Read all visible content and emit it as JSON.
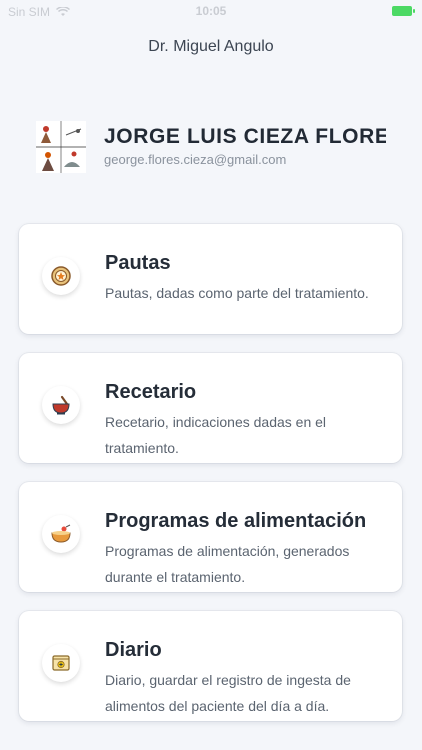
{
  "status_bar": {
    "carrier": "Sin SIM",
    "time": "10:05"
  },
  "header": {
    "doctor_name": "Dr. Miguel Angulo"
  },
  "profile": {
    "name": "JORGE LUIS CIEZA FLORES",
    "email": "george.flores.cieza@gmail.com"
  },
  "cards": [
    {
      "title": "Pautas",
      "description": "Pautas, dadas como parte del tratamiento.",
      "icon": "star-seal-icon"
    },
    {
      "title": "Recetario",
      "description": "Recetario, indicaciones dadas en el tratamiento.",
      "icon": "mortar-pestle-icon"
    },
    {
      "title": "Programas de alimentación",
      "description": "Programas de alimentación, generados durante el tratamiento.",
      "icon": "food-bowl-icon"
    },
    {
      "title": "Diario",
      "description": "Diario, guardar el registro de ingesta de alimentos del paciente del día a día.",
      "icon": "diary-book-icon"
    }
  ],
  "colors": {
    "background": "#f4f6fa",
    "card": "#ffffff",
    "title": "#252d38",
    "battery": "#4cd964"
  }
}
